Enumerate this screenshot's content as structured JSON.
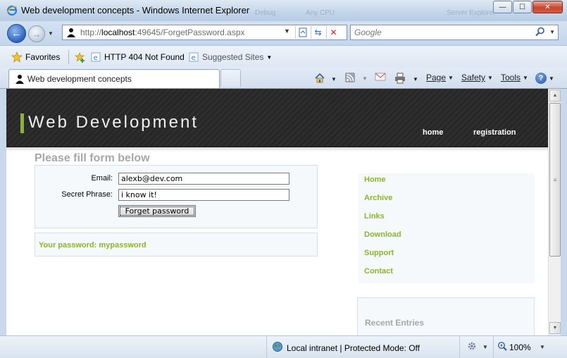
{
  "window": {
    "title": "Web development concepts - Windows Internet Explorer",
    "ghost_tabs": [
      "Debug",
      "Any CPU",
      "Server Explorer"
    ],
    "min_glyph": "—",
    "max_glyph": "☐",
    "close_glyph": "✕"
  },
  "address_bar": {
    "url_prefix": "http://",
    "url_host": "localhost",
    "url_rest": ":49645/ForgetPassword.aspx",
    "search_brand": "Google"
  },
  "favorites_bar": {
    "favorites_label": "Favorites",
    "items": [
      {
        "label": "HTTP 404 Not Found"
      },
      {
        "label": "Suggested Sites"
      }
    ]
  },
  "tabs": [
    {
      "label": "Web development concepts"
    }
  ],
  "command_bar": {
    "page": "Page",
    "safety": "Safety",
    "tools": "Tools",
    "help": "?"
  },
  "site": {
    "brand": "Web Development",
    "menu": {
      "home": "home",
      "registration": "registration"
    },
    "form": {
      "heading": "Please fill form below",
      "email_label": "Email:",
      "email_value": "alexb@dev.com",
      "phrase_label": "Secret Phrase:",
      "phrase_value": "i know it!",
      "submit_label": "Forget password"
    },
    "result": "Your password: mypassword",
    "sidebar": [
      "Home",
      "Archive",
      "Links",
      "Download",
      "Support",
      "Contact"
    ],
    "recent_heading": "Recent Entries"
  },
  "status_bar": {
    "zone": "Local intranet | Protected Mode: Off",
    "zoom": "100%"
  },
  "colors": {
    "accent_green": "#8cb32d",
    "header_dark": "#2a2a2a",
    "panel_bg": "#f6f9fb"
  }
}
